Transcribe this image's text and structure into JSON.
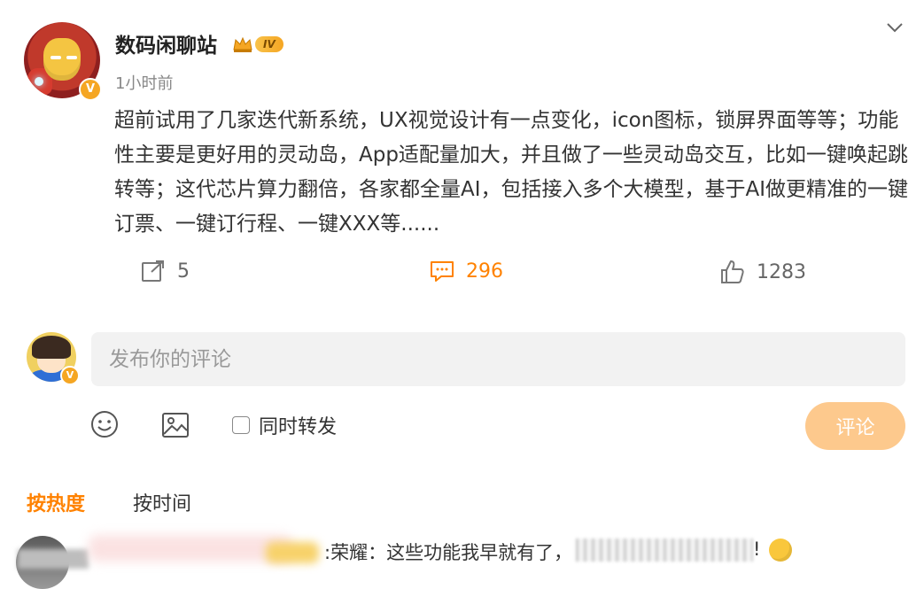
{
  "post": {
    "author": "数码闲聊站",
    "level_badge": "IV",
    "verified_badge": "V",
    "time": "1小时前",
    "text": "超前试用了几家迭代新系统，UX视觉设计有一点变化，icon图标，锁屏界面等等；功能性主要是更好用的灵动岛，App适配量加大，并且做了一些灵动岛交互，比如一键唤起跳转等；这代芯片算力翻倍，各家都全量AI，包括接入多个大模型，基于AI做更精准的一键订票、一键订行程、一键XXX等......"
  },
  "actions": {
    "forward_count": "5",
    "comment_count": "296",
    "like_count": "1283"
  },
  "composer": {
    "placeholder": "发布你的评论",
    "repost_label": "同时转发",
    "submit_label": "评论",
    "user_badge": "V"
  },
  "sort_tabs": {
    "hot": "按热度",
    "time": "按时间"
  },
  "first_comment": {
    "text": ":荣耀：这些功能我早就有了，",
    "end": "!"
  },
  "colors": {
    "accent": "#ff8200",
    "submit_disabled": "#fdc98d",
    "input_bg": "#f2f2f2"
  },
  "icons": {
    "collapse": "chevron-down-icon",
    "forward": "share-icon",
    "comment": "comment-icon",
    "like": "thumbs-up-icon",
    "emoji": "smiley-icon",
    "image": "image-icon"
  }
}
